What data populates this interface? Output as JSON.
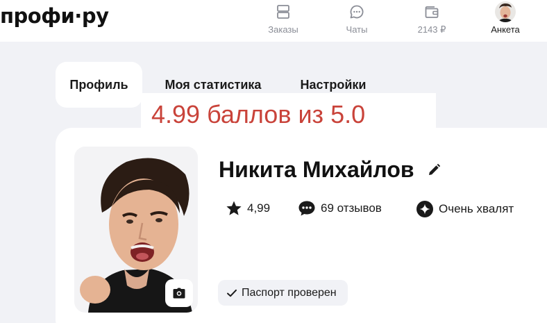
{
  "header": {
    "logo": "профи·ру",
    "nav": [
      {
        "label": "Заказы",
        "icon": "orders-icon"
      },
      {
        "label": "Чаты",
        "icon": "chat-icon"
      },
      {
        "label": "2143 ₽",
        "icon": "wallet-icon"
      },
      {
        "label": "Анкета",
        "icon": "avatar"
      }
    ]
  },
  "tabs": [
    {
      "label": "Профиль",
      "active": true
    },
    {
      "label": "Моя статистика",
      "active": false
    },
    {
      "label": "Настройки",
      "active": false
    }
  ],
  "overlay_text": "4.99 баллов из 5.0",
  "profile": {
    "name": "Никита Михайлов",
    "rating": "4,99",
    "reviews": "69 отзывов",
    "badge": "Очень хвалят",
    "passport": "Паспорт проверен"
  },
  "colors": {
    "accent_red": "#c9433a",
    "page_bg": "#f1f2f6"
  }
}
